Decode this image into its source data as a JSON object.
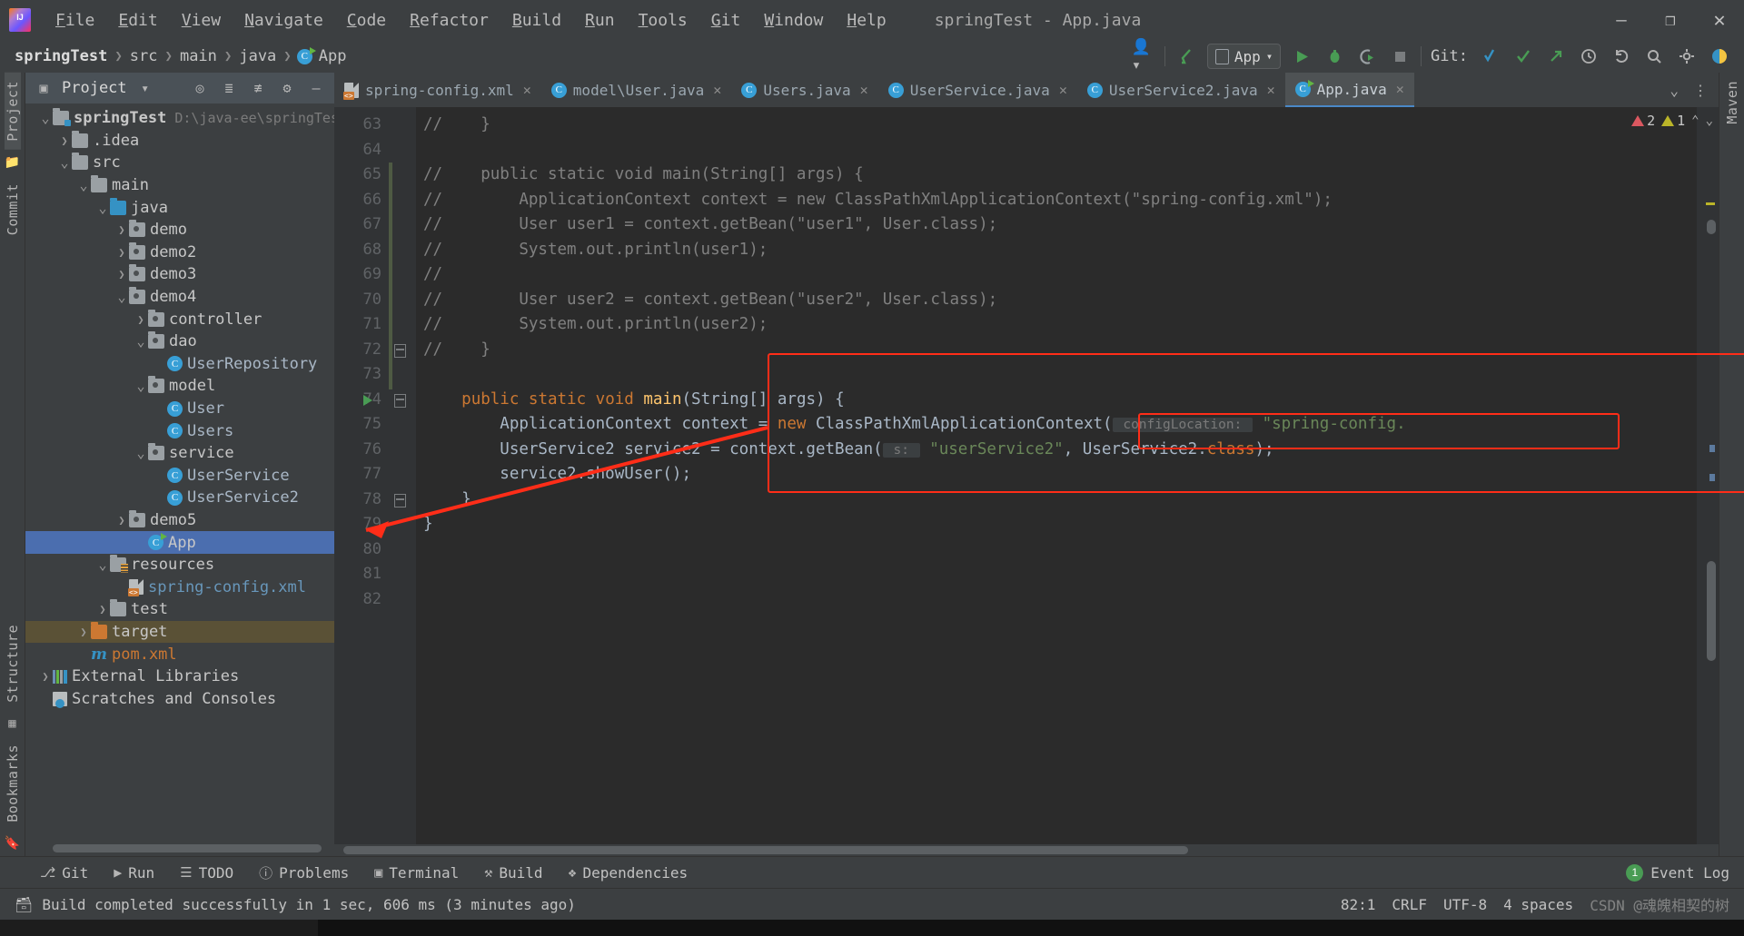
{
  "window": {
    "title": "springTest - App.java",
    "minimize": "–",
    "maximize": "❐",
    "close": "✕"
  },
  "menu": [
    {
      "label": "File"
    },
    {
      "label": "Edit"
    },
    {
      "label": "View"
    },
    {
      "label": "Navigate"
    },
    {
      "label": "Code"
    },
    {
      "label": "Refactor"
    },
    {
      "label": "Build"
    },
    {
      "label": "Run"
    },
    {
      "label": "Tools"
    },
    {
      "label": "Git"
    },
    {
      "label": "Window"
    },
    {
      "label": "Help"
    }
  ],
  "breadcrumb": [
    {
      "label": "springTest",
      "bold": true
    },
    {
      "label": "src",
      "bold": false
    },
    {
      "label": "main",
      "bold": false
    },
    {
      "label": "java",
      "bold": false
    },
    {
      "label": "App",
      "bold": false
    }
  ],
  "toolbar": {
    "run_config": "App",
    "git_label": "Git:",
    "icons": {
      "profile": "profile-icon",
      "build": "build-hammer-icon",
      "run": "run-icon",
      "debug": "debug-icon",
      "coverage": "run-with-coverage-icon",
      "stop": "stop-icon",
      "update": "git-update-icon",
      "commit": "git-commit-icon",
      "push": "git-push-icon",
      "history": "git-history-icon",
      "rollback": "git-rollback-icon",
      "search": "search-everywhere-icon",
      "settings": "settings-icon",
      "ide_help": "ide-assistant-icon"
    }
  },
  "rail": {
    "left_top": [
      "Project"
    ],
    "left_mid": [
      "Commit"
    ],
    "left_bottom": [
      "Structure",
      "Bookmarks"
    ],
    "right": [
      "Maven"
    ]
  },
  "project_panel": {
    "title": "Project",
    "header_icons": [
      "locate-icon",
      "expand-all-icon",
      "collapse-all-icon",
      "settings-icon",
      "hide-icon"
    ],
    "tree": [
      {
        "indent": 0,
        "arrow": "v",
        "icon": "folder-module",
        "label": "springTest",
        "bold": true,
        "path": "D:\\java-ee\\springTes",
        "color": "default"
      },
      {
        "indent": 1,
        "arrow": ">",
        "icon": "folder-gray",
        "label": ".idea",
        "color": "default"
      },
      {
        "indent": 1,
        "arrow": "v",
        "icon": "folder-gray",
        "label": "src",
        "color": "default"
      },
      {
        "indent": 2,
        "arrow": "v",
        "icon": "folder-gray",
        "label": "main",
        "color": "default"
      },
      {
        "indent": 3,
        "arrow": "v",
        "icon": "folder-blue",
        "label": "java",
        "color": "default"
      },
      {
        "indent": 4,
        "arrow": ">",
        "icon": "folder-source",
        "label": "demo",
        "color": "default"
      },
      {
        "indent": 4,
        "arrow": ">",
        "icon": "folder-source",
        "label": "demo2",
        "color": "default"
      },
      {
        "indent": 4,
        "arrow": ">",
        "icon": "folder-source",
        "label": "demo3",
        "color": "default"
      },
      {
        "indent": 4,
        "arrow": "v",
        "icon": "folder-source",
        "label": "demo4",
        "color": "default"
      },
      {
        "indent": 5,
        "arrow": ">",
        "icon": "folder-source",
        "label": "controller",
        "color": "default"
      },
      {
        "indent": 5,
        "arrow": "v",
        "icon": "folder-source",
        "label": "dao",
        "color": "default"
      },
      {
        "indent": 6,
        "arrow": "",
        "icon": "class",
        "label": "UserRepository",
        "color": "blue"
      },
      {
        "indent": 5,
        "arrow": "v",
        "icon": "folder-source",
        "label": "model",
        "color": "default"
      },
      {
        "indent": 6,
        "arrow": "",
        "icon": "class",
        "label": "User",
        "color": "blue"
      },
      {
        "indent": 6,
        "arrow": "",
        "icon": "class",
        "label": "Users",
        "color": "blue"
      },
      {
        "indent": 5,
        "arrow": "v",
        "icon": "folder-source",
        "label": "service",
        "color": "default"
      },
      {
        "indent": 6,
        "arrow": "",
        "icon": "class",
        "label": "UserService",
        "color": "blue"
      },
      {
        "indent": 6,
        "arrow": "",
        "icon": "class",
        "label": "UserService2",
        "color": "blue"
      },
      {
        "indent": 4,
        "arrow": ">",
        "icon": "folder-source",
        "label": "demo5",
        "color": "default"
      },
      {
        "indent": 5,
        "arrow": "",
        "icon": "class-runnable",
        "label": "App",
        "color": "default",
        "selected": true
      },
      {
        "indent": 3,
        "arrow": "v",
        "icon": "folder-resources",
        "label": "resources",
        "color": "default"
      },
      {
        "indent": 4,
        "arrow": "",
        "icon": "xml",
        "label": "spring-config.xml",
        "color": "xml"
      },
      {
        "indent": 3,
        "arrow": ">",
        "icon": "folder-gray",
        "label": "test",
        "color": "default"
      },
      {
        "indent": 2,
        "arrow": ">",
        "icon": "folder-orange",
        "label": "target",
        "color": "default",
        "excluded": true
      },
      {
        "indent": 2,
        "arrow": "",
        "icon": "maven",
        "label": "pom.xml",
        "color": "pom"
      },
      {
        "indent": 0,
        "arrow": ">",
        "icon": "library",
        "label": "External Libraries",
        "color": "default"
      },
      {
        "indent": 0,
        "arrow": "",
        "icon": "scratch",
        "label": "Scratches and Consoles",
        "color": "default"
      }
    ]
  },
  "editor": {
    "tabs": [
      {
        "label": "spring-config.xml",
        "icon": "xml",
        "active": false
      },
      {
        "label": "model\\User.java",
        "icon": "class",
        "active": false
      },
      {
        "label": "Users.java",
        "icon": "class",
        "active": false
      },
      {
        "label": "UserService.java",
        "icon": "class",
        "active": false
      },
      {
        "label": "UserService2.java",
        "icon": "class",
        "active": false
      },
      {
        "label": "App.java",
        "icon": "class-runnable",
        "active": true
      }
    ],
    "tabs_overflow": "⌄",
    "tabs_menu": "⋮",
    "inspections": {
      "errors": "2",
      "warnings": "1",
      "up": "⌃",
      "down": "⌄"
    },
    "first_line_number": 63,
    "lines": [
      {
        "n": 63,
        "tokens": [
          {
            "t": "//    }",
            "c": "cm"
          }
        ],
        "fold": false
      },
      {
        "n": 64,
        "tokens": [],
        "fold": false
      },
      {
        "n": 65,
        "tokens": [
          {
            "t": "//    public static void main(String[] args) {",
            "c": "cm"
          }
        ],
        "green": true
      },
      {
        "n": 66,
        "tokens": [
          {
            "t": "//        ApplicationContext context = new ClassPathXmlApplicationContext(\"spring-config.xml\");",
            "c": "cm"
          }
        ],
        "green": true
      },
      {
        "n": 67,
        "tokens": [
          {
            "t": "//        User user1 = context.getBean(\"user1\", User.class);",
            "c": "cm"
          }
        ],
        "green": true
      },
      {
        "n": 68,
        "tokens": [
          {
            "t": "//        System.out.println(user1);",
            "c": "cm"
          }
        ],
        "green": true
      },
      {
        "n": 69,
        "tokens": [
          {
            "t": "//",
            "c": "cm"
          }
        ],
        "green": true
      },
      {
        "n": 70,
        "tokens": [
          {
            "t": "//        User user2 = context.getBean(\"user2\", User.class);",
            "c": "cm"
          }
        ],
        "green": true
      },
      {
        "n": 71,
        "tokens": [
          {
            "t": "//        System.out.println(user2);",
            "c": "cm"
          }
        ],
        "green": true
      },
      {
        "n": 72,
        "tokens": [
          {
            "t": "//    }",
            "c": "cm"
          }
        ],
        "green": true,
        "fold": true
      },
      {
        "n": 73,
        "tokens": [],
        "green": true
      },
      {
        "n": 74,
        "tokens": [
          {
            "t": "    ",
            "c": "pln"
          },
          {
            "t": "public static void ",
            "c": "kw"
          },
          {
            "t": "main",
            "c": "mth"
          },
          {
            "t": "(",
            "c": "pln"
          },
          {
            "t": "String",
            "c": "typ"
          },
          {
            "t": "[] args) {",
            "c": "pln"
          }
        ],
        "runnable": true,
        "fold": true
      },
      {
        "n": 75,
        "tokens": [
          {
            "t": "        ApplicationContext context = ",
            "c": "pln"
          },
          {
            "t": "new ",
            "c": "kw"
          },
          {
            "t": "ClassPathXmlApplicationContext(",
            "c": "pln"
          },
          {
            "t": " configLocation: ",
            "c": "hint"
          },
          {
            "t": " ",
            "c": "pln"
          },
          {
            "t": "\"spring-config.",
            "c": "str"
          }
        ]
      },
      {
        "n": 76,
        "tokens": [
          {
            "t": "        UserService2 service2 = context.getBean(",
            "c": "pln"
          },
          {
            "t": " s: ",
            "c": "hint"
          },
          {
            "t": " ",
            "c": "pln"
          },
          {
            "t": "\"userService2\"",
            "c": "str"
          },
          {
            "t": ", UserService2.",
            "c": "pln"
          },
          {
            "t": "class",
            "c": "kw"
          },
          {
            "t": ");",
            "c": "pln"
          }
        ]
      },
      {
        "n": 77,
        "tokens": [
          {
            "t": "        service2.showUser();",
            "c": "pln"
          }
        ]
      },
      {
        "n": 78,
        "tokens": [
          {
            "t": "    }",
            "c": "pln"
          }
        ],
        "fold": true
      },
      {
        "n": 79,
        "tokens": [
          {
            "t": "}",
            "c": "pln"
          }
        ]
      },
      {
        "n": 80,
        "tokens": []
      },
      {
        "n": 81,
        "tokens": []
      },
      {
        "n": 82,
        "tokens": []
      }
    ]
  },
  "tool_windows": [
    {
      "label": "Git",
      "icon": "git-branch-icon"
    },
    {
      "label": "Run",
      "icon": "run-icon"
    },
    {
      "label": "TODO",
      "icon": "todo-icon"
    },
    {
      "label": "Problems",
      "icon": "problems-icon"
    },
    {
      "label": "Terminal",
      "icon": "terminal-icon"
    },
    {
      "label": "Build",
      "icon": "build-hammer-icon"
    },
    {
      "label": "Dependencies",
      "icon": "dependencies-icon"
    }
  ],
  "event_log": {
    "count": "1",
    "label": "Event Log"
  },
  "status_bar": {
    "message": "Build completed successfully in 1 sec, 606 ms (3 minutes ago)",
    "caret": "82:1",
    "line_sep": "CRLF",
    "encoding": "UTF-8",
    "indent": "4 spaces",
    "watermark": "CSDN @魂魄相契的树"
  },
  "colors": {
    "accent_blue": "#4b6eaf",
    "annotation_red": "#ff2d18",
    "editor_bg": "#2b2b2b",
    "panel_bg": "#3c3f41",
    "string_green": "#6a8759",
    "keyword_orange": "#cc7832",
    "class_blue": "#a9b7c6"
  }
}
